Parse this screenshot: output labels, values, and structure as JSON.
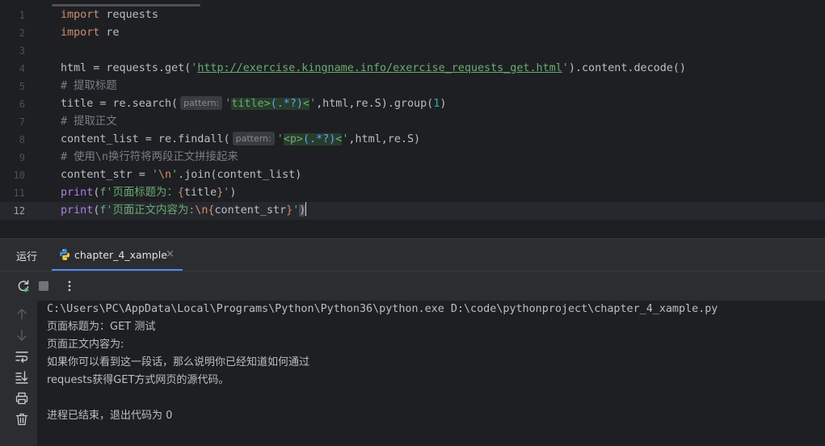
{
  "editor": {
    "line_numbers": [
      "1",
      "2",
      "3",
      "4",
      "5",
      "6",
      "7",
      "8",
      "9",
      "10",
      "11",
      "12"
    ],
    "kw_import": "import",
    "line1_mod": " requests",
    "line2_mod": " re",
    "l4_a": "html = requests.get(",
    "l4_q1": "'",
    "l4_url": "http://exercise.kingname.info/exercise_requests_get.html",
    "l4_q2": "'",
    "l4_b": ").content.decode()",
    "l5_comment": "# 提取标题",
    "l6_a": "title = re.search(",
    "hint_pattern": "pattern:",
    "l6_q1": "'",
    "l6_s1": "title>",
    "l6_esc": "(.*?)",
    "l6_s2": "<",
    "l6_q2": "'",
    "l6_b": ",html,re.S).group(",
    "l6_num": "1",
    "l6_c": ")",
    "l7_comment": "# 提取正文",
    "l8_a": "content_list = re.findall(",
    "l8_q1": "'",
    "l8_s1": "<p>",
    "l8_esc": "(.*?)",
    "l8_s2": "<",
    "l8_q2": "'",
    "l8_b": ",html,re.S)",
    "l9_comment": "# 使用\\n换行符将两段正文拼接起来",
    "l10_a": "content_str = ",
    "l10_s1": "'",
    "l10_esc": "\\n",
    "l10_s2": "'",
    "l10_b": ".join(content_list)",
    "fn_print": "print",
    "l11_a": "(",
    "l11_s1": "f'页面标题为：",
    "l11_i1": "{",
    "l11_var": "title",
    "l11_i2": "}",
    "l11_s2": "'",
    "l11_b": ")",
    "l12_a": "(",
    "l12_s1": "f'页面正文内容为:",
    "l12_esc": "\\n",
    "l12_i1": "{",
    "l12_var": "content_str",
    "l12_i2": "}",
    "l12_s2": "'",
    "l12_b": ")"
  },
  "run_panel": {
    "title": "运行",
    "tab_label": "chapter_4_xample",
    "tab_close": "×"
  },
  "console": {
    "lines": [
      "C:\\Users\\PC\\AppData\\Local\\Programs\\Python\\Python36\\python.exe D:\\code\\pythonproject\\chapter_4_xample.py",
      "页面标题为：GET 测试",
      "页面正文内容为:",
      "如果你可以看到这一段话，那么说明你已经知道如何通过",
      "requests获得GET方式网页的源代码。",
      "",
      "进程已结束，退出代码为 0"
    ]
  },
  "colors": {
    "keyword": "#cf8e6d",
    "string": "#6aab73",
    "comment": "#7a7e85",
    "number": "#2aacb8",
    "function": "#b07ee3",
    "accent": "#548af7",
    "rerun_green": "#5fb865"
  },
  "icons": {
    "tab": "python-icon",
    "toolbar": [
      "rerun-icon",
      "stop-icon",
      "more-icon"
    ],
    "side": [
      "arrow-up-icon",
      "arrow-down-icon",
      "soft-wrap-icon",
      "scroll-to-end-icon",
      "print-icon",
      "trash-icon"
    ]
  }
}
